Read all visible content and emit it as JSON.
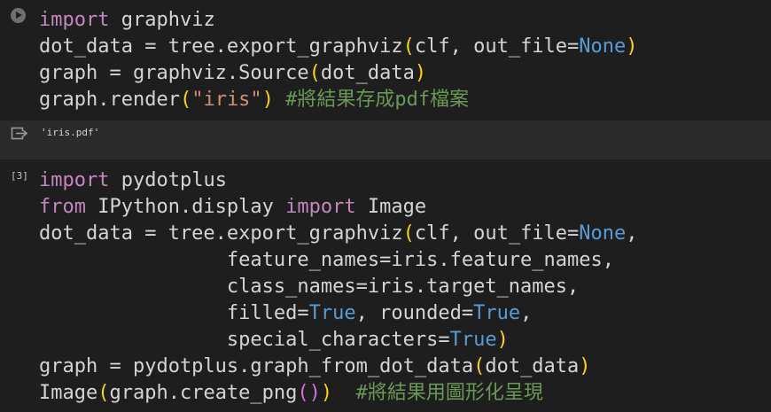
{
  "colors": {
    "background": "#1e1e1e",
    "output_background": "#2b2b2b",
    "keyword": "#c586c0",
    "constant": "#569cd6",
    "string": "#ce9178",
    "comment": "#6a9955",
    "bracket_outer": "#ffd700",
    "bracket_inner": "#da70d6",
    "text": "#d4d4d4"
  },
  "cell1": {
    "run_icon": "play-circle-icon",
    "lines": [
      [
        {
          "t": "import",
          "k": "kw"
        },
        {
          "t": " graphviz",
          "k": "fn"
        }
      ],
      [
        {
          "t": "dot_data = tree.export_graphviz",
          "k": "fn"
        },
        {
          "t": "(",
          "k": "br1"
        },
        {
          "t": "clf, out_file=",
          "k": "fn"
        },
        {
          "t": "None",
          "k": "cst"
        },
        {
          "t": ")",
          "k": "br1"
        }
      ],
      [
        {
          "t": "graph = graphviz.Source",
          "k": "fn"
        },
        {
          "t": "(",
          "k": "br1"
        },
        {
          "t": "dot_data",
          "k": "fn"
        },
        {
          "t": ")",
          "k": "br1"
        }
      ],
      [
        {
          "t": "graph.render",
          "k": "fn"
        },
        {
          "t": "(",
          "k": "br1"
        },
        {
          "t": "\"iris\"",
          "k": "str"
        },
        {
          "t": ")",
          "k": "br1"
        },
        {
          "t": " #將結果存成pdf檔案",
          "k": "cm"
        }
      ]
    ]
  },
  "output": {
    "icon": "output-arrow-icon",
    "text": "'iris.pdf'"
  },
  "cell2": {
    "exec_count": "[3]",
    "lines": [
      [
        {
          "t": "import",
          "k": "kw"
        },
        {
          "t": " pydotplus",
          "k": "fn"
        }
      ],
      [
        {
          "t": "from",
          "k": "kw"
        },
        {
          "t": " IPython.display ",
          "k": "fn"
        },
        {
          "t": "import",
          "k": "kw"
        },
        {
          "t": " Image",
          "k": "fn"
        }
      ],
      [
        {
          "t": "dot_data = tree.export_graphviz",
          "k": "fn"
        },
        {
          "t": "(",
          "k": "br1"
        },
        {
          "t": "clf, out_file=",
          "k": "fn"
        },
        {
          "t": "None",
          "k": "cst"
        },
        {
          "t": ",",
          "k": "fn"
        }
      ],
      [
        {
          "t": "                feature_names=iris.feature_names,",
          "k": "fn"
        }
      ],
      [
        {
          "t": "                class_names=iris.target_names,",
          "k": "fn"
        }
      ],
      [
        {
          "t": "                filled=",
          "k": "fn"
        },
        {
          "t": "True",
          "k": "cst"
        },
        {
          "t": ", rounded=",
          "k": "fn"
        },
        {
          "t": "True",
          "k": "cst"
        },
        {
          "t": ",",
          "k": "fn"
        }
      ],
      [
        {
          "t": "                special_characters=",
          "k": "fn"
        },
        {
          "t": "True",
          "k": "cst"
        },
        {
          "t": ")",
          "k": "br1"
        }
      ],
      [
        {
          "t": "graph = pydotplus.graph_from_dot_data",
          "k": "fn"
        },
        {
          "t": "(",
          "k": "br1"
        },
        {
          "t": "dot_data",
          "k": "fn"
        },
        {
          "t": ")",
          "k": "br1"
        }
      ],
      [
        {
          "t": "Image",
          "k": "fn"
        },
        {
          "t": "(",
          "k": "br1"
        },
        {
          "t": "graph.create_png",
          "k": "fn"
        },
        {
          "t": "()",
          "k": "br2"
        },
        {
          "t": ")",
          "k": "br1"
        },
        {
          "t": "  #將結果用圖形化呈現",
          "k": "cm"
        }
      ]
    ]
  }
}
